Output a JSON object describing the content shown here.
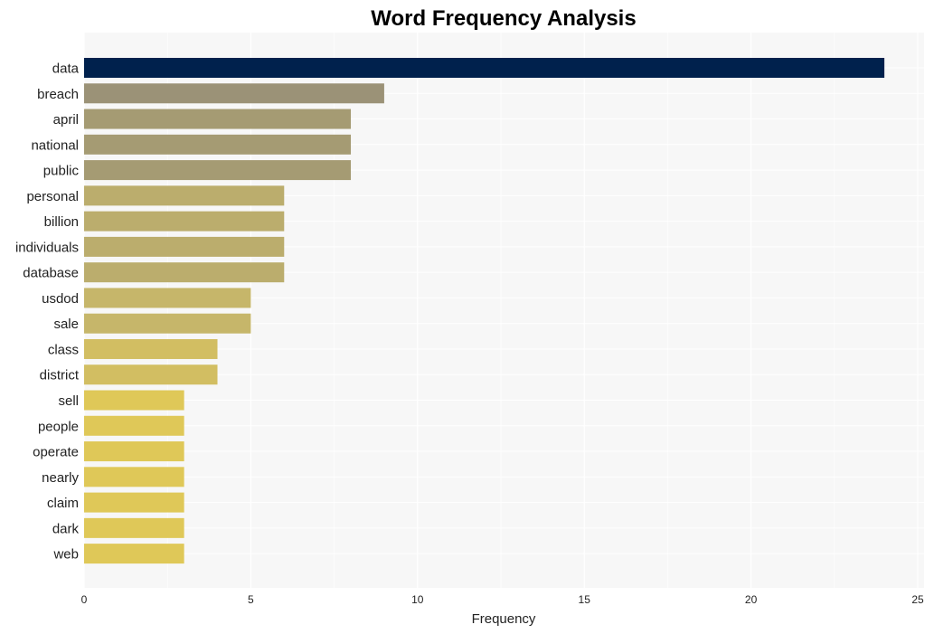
{
  "chart_data": {
    "type": "bar",
    "orientation": "horizontal",
    "title": "Word Frequency Analysis",
    "xlabel": "Frequency",
    "ylabel": "",
    "xlim": [
      0,
      25
    ],
    "xticks": [
      0,
      5,
      10,
      15,
      20,
      25
    ],
    "grid": true,
    "legend": "none",
    "categories": [
      "data",
      "breach",
      "april",
      "national",
      "public",
      "personal",
      "billion",
      "individuals",
      "database",
      "usdod",
      "sale",
      "class",
      "district",
      "sell",
      "people",
      "operate",
      "nearly",
      "claim",
      "dark",
      "web"
    ],
    "values": [
      24,
      9,
      8,
      8,
      8,
      6,
      6,
      6,
      6,
      5,
      5,
      4,
      4,
      3,
      3,
      3,
      3,
      3,
      3,
      3
    ],
    "colors": {
      "top": "#00214d",
      "9": "#9b9277",
      "8": "#a59b73",
      "6": "#bbad6d",
      "5": "#c6b66a",
      "4": "#d2be62",
      "3": "#dfc858",
      "plot_background": "#f7f7f7",
      "grid": "#ffffff"
    }
  }
}
